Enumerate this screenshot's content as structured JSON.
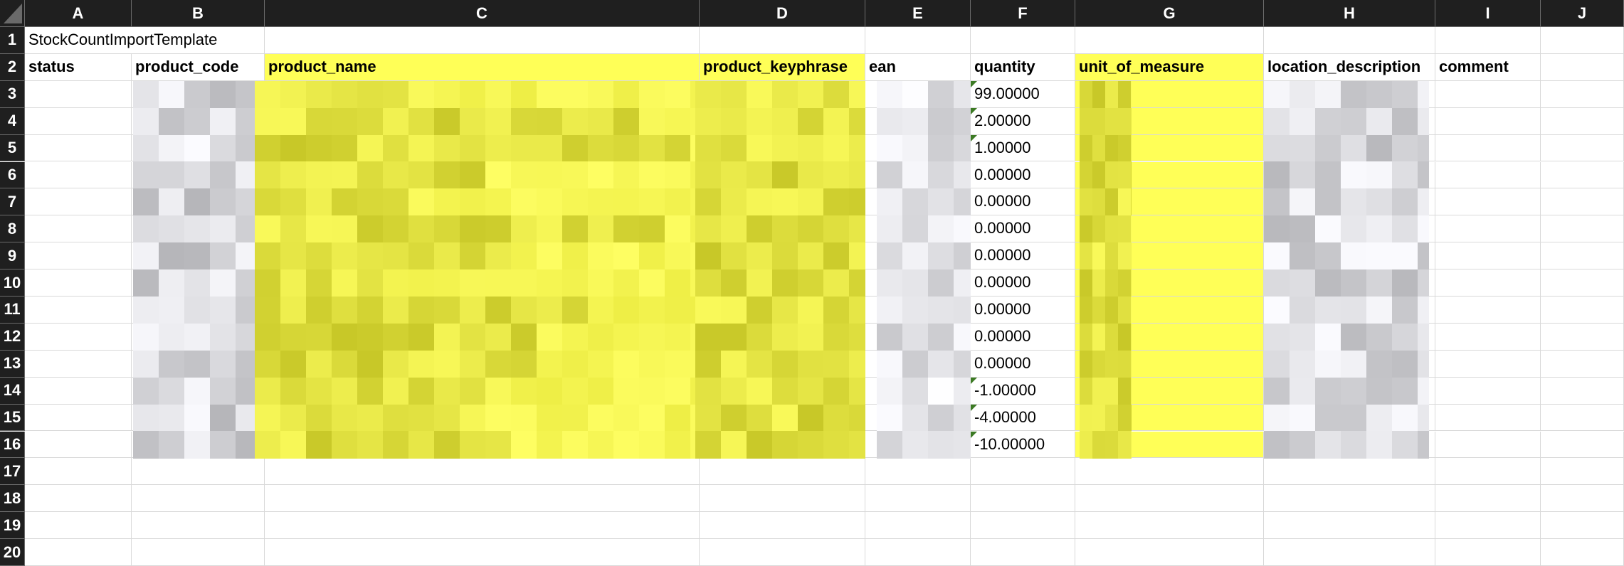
{
  "columns": [
    "A",
    "B",
    "C",
    "D",
    "E",
    "F",
    "G",
    "H",
    "I",
    "J"
  ],
  "rows": [
    "1",
    "2",
    "3",
    "4",
    "5",
    "6",
    "7",
    "8",
    "9",
    "10",
    "11",
    "12",
    "13",
    "14",
    "15",
    "16",
    "17",
    "18",
    "19",
    "20"
  ],
  "title_cell": "StockCountImportTemplate",
  "headers": [
    "status",
    "product_code",
    "product_name",
    "product_keyphrase",
    "ean",
    "quantity",
    "unit_of_measure",
    "location_description",
    "comment"
  ],
  "quantities": [
    "99.00000",
    "2.00000",
    "1.00000",
    "0.00000",
    "0.00000",
    "0.00000",
    "0.00000",
    "0.00000",
    "0.00000",
    "0.00000",
    "0.00000",
    "-1.00000",
    "-4.00000",
    "-10.00000"
  ],
  "highlight_color": "#ffff57",
  "header_bg": "#1f1f1f",
  "redacted_columns": [
    "product_code",
    "product_name",
    "product_keyphrase",
    "ean",
    "unit_of_measure",
    "location_description"
  ]
}
